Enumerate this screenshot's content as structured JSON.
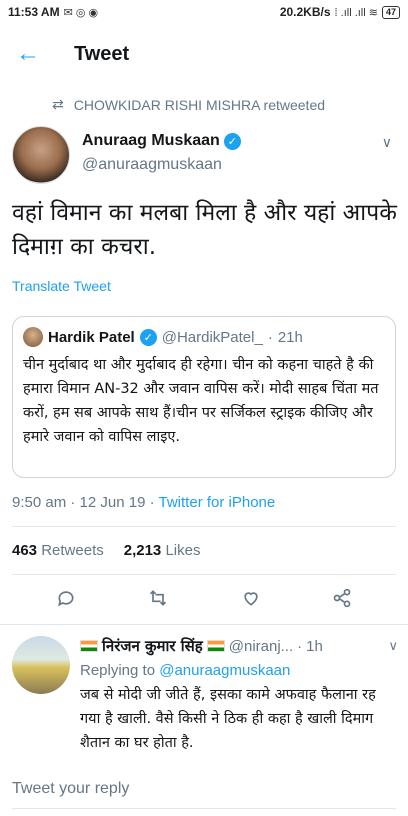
{
  "statusbar": {
    "time": "11:53 AM",
    "speed": "20.2KB/s",
    "battery": "47"
  },
  "appbar": {
    "title": "Tweet"
  },
  "retweet_label": "CHOWKIDAR RISHI MISHRA retweeted",
  "tweet": {
    "author_name": "Anuraag Muskaan",
    "author_handle": "@anuraagmuskaan",
    "text": "वहां विमान का मलबा मिला है और यहां आपके दिमाग़ का कचरा.",
    "translate": "Translate Tweet",
    "time": "9:50 am",
    "date": "12 Jun 19",
    "source": "Twitter for iPhone",
    "retweets_count": "463",
    "retweets_label": "Retweets",
    "likes_count": "2,213",
    "likes_label": "Likes"
  },
  "quote": {
    "name": "Hardik Patel",
    "handle": "@HardikPatel_",
    "time": "21h",
    "text": "चीन मुर्दाबाद था और मुर्दाबाद ही रहेगा। चीन को कहना चाहते है की हमारा विमान AN-32 और जवान वापिस करें। मोदी साहब चिंता मत करों, हम सब आपके साथ हैं।चीन पर सर्जिकल स्ट्राइक कीजिए और हमारे जवान को वापिस लाइए."
  },
  "reply": {
    "name": "निरंजन कुमार सिंह",
    "handle": "@niranj...",
    "time": "1h",
    "replying_prefix": "Replying to",
    "replying_to": "@anuraagmuskaan",
    "text": "जब से मोदी जी जीते हैं, इसका कामे अफवाह फैलाना रह गया है खाली. वैसे किसी ने ठिक ही कहा है खाली दिमाग शैतान का घर होता है."
  },
  "reply_input": {
    "placeholder": "Tweet your reply"
  },
  "icons": {
    "reply": "reply-icon",
    "retweet": "retweet-icon",
    "like": "heart-icon",
    "share": "share-icon"
  },
  "colors": {
    "accent": "#1da1f2",
    "secondary_text": "#657786"
  }
}
